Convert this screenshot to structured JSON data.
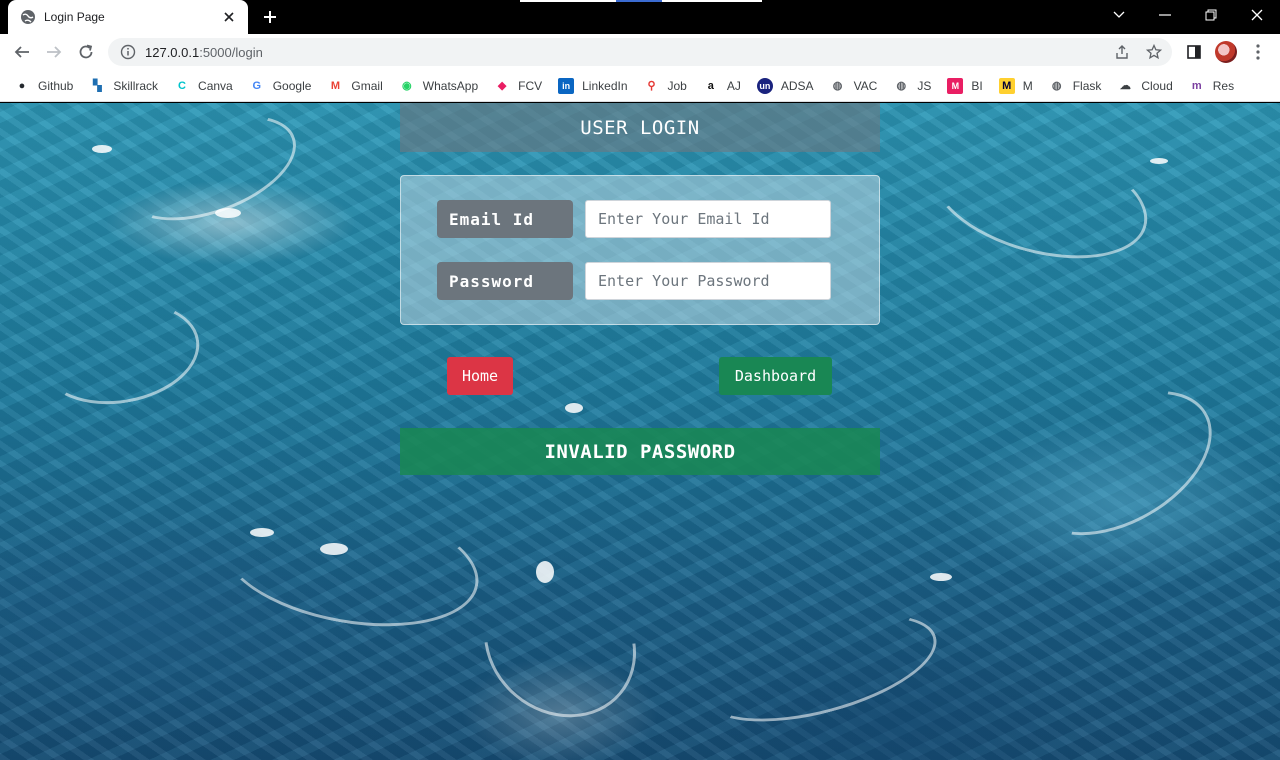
{
  "browser": {
    "tab": {
      "title": "Login Page",
      "icon": "globe-icon"
    },
    "new_tab_icon": "plus-icon",
    "url": {
      "host": "127.0.0.1",
      "path": ":5000/login"
    },
    "bookmarks": [
      {
        "label": "Github",
        "icon": "github-icon",
        "color": "#24292e"
      },
      {
        "label": "Skillrack",
        "icon": "skillrack-icon",
        "color": "#1f6fb2"
      },
      {
        "label": "Canva",
        "icon": "canva-icon",
        "color": "#00c4cc"
      },
      {
        "label": "Google",
        "icon": "google-icon",
        "color": "#4285f4"
      },
      {
        "label": "Gmail",
        "icon": "gmail-icon",
        "color": "#ea4335"
      },
      {
        "label": "WhatsApp",
        "icon": "whatsapp-icon",
        "color": "#25d366"
      },
      {
        "label": "FCV",
        "icon": "fcv-icon",
        "color": "#e91e63"
      },
      {
        "label": "LinkedIn",
        "icon": "linkedin-icon",
        "color": "#0a66c2"
      },
      {
        "label": "Job",
        "icon": "job-icon",
        "color": "#e53935"
      },
      {
        "label": "AJ",
        "icon": "amazon-icon",
        "color": "#111111"
      },
      {
        "label": "ADSA",
        "icon": "unacademy-icon",
        "color": "#1a237e"
      },
      {
        "label": "VAC",
        "icon": "globe-icon",
        "color": "#5f6368"
      },
      {
        "label": "JS",
        "icon": "globe-icon",
        "color": "#5f6368"
      },
      {
        "label": "BI",
        "icon": "m-pink-icon",
        "color": "#e91e63"
      },
      {
        "label": "M",
        "icon": "miro-icon",
        "color": "#ffd02f"
      },
      {
        "label": "Flask",
        "icon": "globe-icon",
        "color": "#5f6368"
      },
      {
        "label": "Cloud",
        "icon": "cloud-icon",
        "color": "#3c4043"
      },
      {
        "label": "Res",
        "icon": "m-purple-icon",
        "color": "#7b3fa0"
      }
    ]
  },
  "page": {
    "header": "USER LOGIN",
    "email": {
      "label": "Email Id",
      "placeholder": "Enter Your Email Id",
      "value": ""
    },
    "password": {
      "label": "Password",
      "placeholder": "Enter Your Password",
      "value": ""
    },
    "home_button": "Home",
    "dashboard_button": "Dashboard",
    "alert": "INVALID PASSWORD",
    "colors": {
      "home": "#dc3545",
      "dashboard": "#198754",
      "label_bg": "#6c757d",
      "alert_bg": "#198754"
    }
  }
}
